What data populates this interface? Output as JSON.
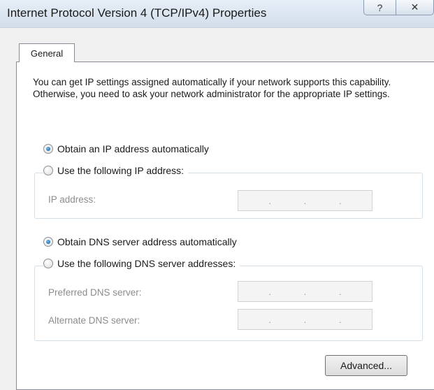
{
  "window": {
    "title": "Internet Protocol Version 4 (TCP/IPv4) Properties",
    "help_glyph": "?",
    "close_glyph": "✕"
  },
  "tabs": [
    {
      "label": "General",
      "selected": true
    }
  ],
  "intro_text": "You can get IP settings assigned automatically if your network supports this capability. Otherwise, you need to ask your network administrator for the appropriate IP settings.",
  "ip_section": {
    "auto_option": {
      "label": "Obtain an IP address automatically",
      "checked": true
    },
    "manual_option": {
      "label": "Use the following IP address:",
      "checked": false
    },
    "fields": [
      {
        "label": "IP address:",
        "dots": [
          ".",
          ".",
          "."
        ]
      }
    ]
  },
  "dns_section": {
    "auto_option": {
      "label": "Obtain DNS server address automatically",
      "checked": true
    },
    "manual_option": {
      "label": "Use the following DNS server addresses:",
      "checked": false
    },
    "fields": [
      {
        "label": "Preferred DNS server:",
        "dots": [
          ".",
          ".",
          "."
        ]
      },
      {
        "label": "Alternate DNS server:",
        "dots": [
          ".",
          ".",
          "."
        ]
      }
    ]
  },
  "buttons": {
    "advanced_label": "Advanced..."
  }
}
